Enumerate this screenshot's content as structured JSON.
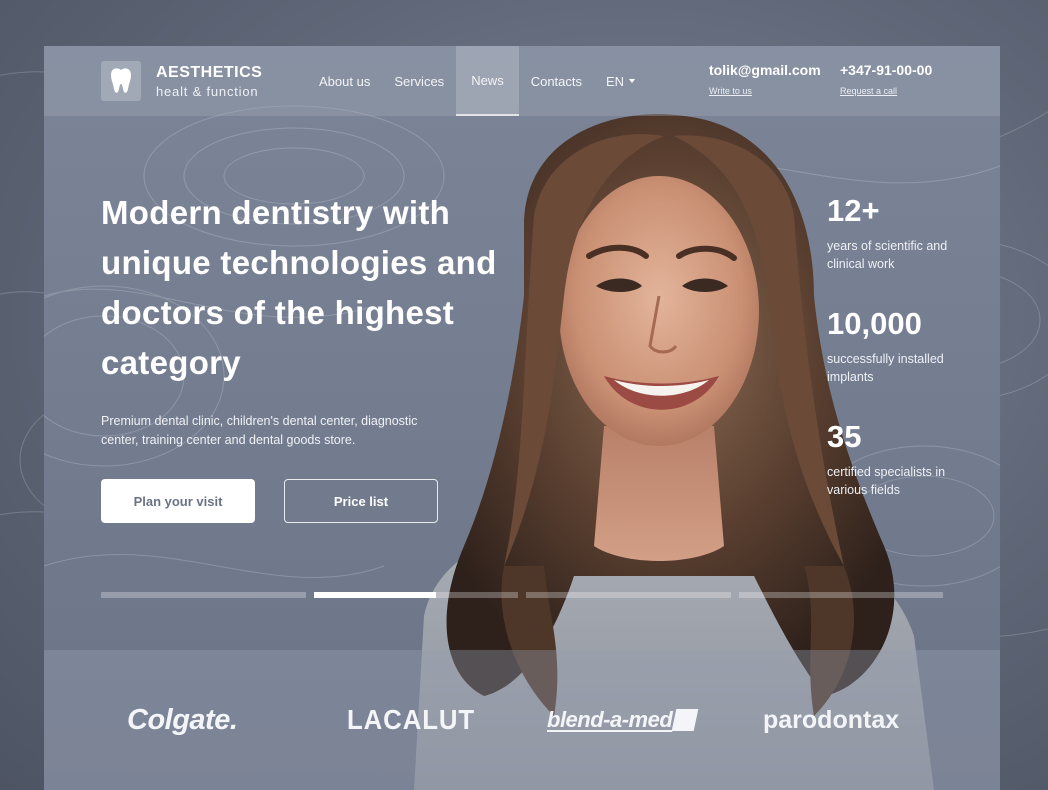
{
  "brand": {
    "name": "AESTHETICS",
    "tagline": "healt & function"
  },
  "nav": {
    "items": [
      "About us",
      "Services",
      "News",
      "Contacts"
    ],
    "active": "News",
    "language": "EN"
  },
  "contacts": {
    "email": "tolik@gmail.com",
    "email_action": "Write to us",
    "phone": "+347-91-00-00",
    "phone_action": "Request a call"
  },
  "hero": {
    "headline": "Modern dentistry with unique technologies and doctors of the highest category",
    "lead": "Premium dental clinic, children's dental center, diagnostic center, training center and dental goods store.",
    "primary_button": "Plan your visit",
    "secondary_button": "Price list"
  },
  "stats": [
    {
      "value": "12+",
      "label": "years of scientific and clinical work"
    },
    {
      "value": "10,000",
      "label": "successfully installed implants"
    },
    {
      "value": "35",
      "label": "certified specialists in various fields"
    }
  ],
  "slider": {
    "segments": 4,
    "active_index": 1,
    "active_progress": 0.6
  },
  "partners": [
    "Colgate.",
    "LACALUT",
    "blend-a-med",
    "parodontax"
  ],
  "colors": {
    "background": "#737c8f",
    "header_overlay": "#a0a8b8",
    "button_text": "#6a7285",
    "white": "#ffffff"
  },
  "icons": {
    "logo": "tooth-icon",
    "language": "caret-down-icon"
  }
}
